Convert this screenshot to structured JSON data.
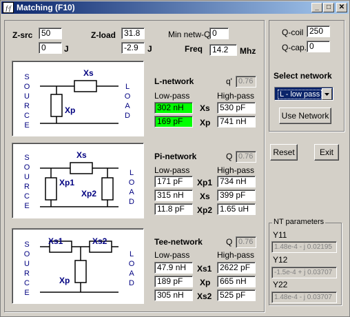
{
  "window": {
    "title": "Matching (F10)",
    "icon_text": "f·f",
    "min": "_",
    "max": "□",
    "close": "✕"
  },
  "source_load": {
    "zsrc_label": "Z-src",
    "zsrc_re": "50",
    "zsrc_im": "0",
    "zsrc_j": "J",
    "zload_label": "Z-load",
    "zload_re": "31.8",
    "zload_im": "-2.9",
    "zload_j": "J",
    "min_q_label": "Min netw-Q",
    "min_q": "0",
    "freq_label": "Freq",
    "freq": "14.2",
    "freq_unit": "Mhz"
  },
  "diagram": {
    "source_letters": [
      "S",
      "O",
      "U",
      "R",
      "C",
      "E"
    ],
    "load_letters": [
      "L",
      "O",
      "A",
      "D"
    ],
    "l_xs": "Xs",
    "l_xp": "Xp",
    "pi_xs": "Xs",
    "pi_xp1": "Xp1",
    "pi_xp2": "Xp2",
    "tee_xs1": "Xs1",
    "tee_xs2": "Xs2",
    "tee_xp": "Xp"
  },
  "l_network": {
    "title": "L-network",
    "q_label": "q'",
    "q": "0.76",
    "lowpass": "Low-pass",
    "highpass": "High-pass",
    "rows": [
      {
        "lp": "302 nH",
        "name": "Xs",
        "hp": "530 pF"
      },
      {
        "lp": "169 pF",
        "name": "Xp",
        "hp": "741 nH"
      }
    ]
  },
  "pi_network": {
    "title": "Pi-network",
    "q_label": "Q",
    "q": "0.76",
    "lowpass": "Low-pass",
    "highpass": "High-pass",
    "rows": [
      {
        "lp": "171 pF",
        "name": "Xp1",
        "hp": "734 nH"
      },
      {
        "lp": "315 nH",
        "name": "Xs",
        "hp": "399 pF"
      },
      {
        "lp": "11.8 pF",
        "name": "Xp2",
        "hp": "1.65 uH"
      }
    ]
  },
  "tee_network": {
    "title": "Tee-network",
    "q_label": "Q",
    "q": "0.76",
    "lowpass": "Low-pass",
    "highpass": "High-pass",
    "rows": [
      {
        "lp": "47.9 nH",
        "name": "Xs1",
        "hp": "2622 pF"
      },
      {
        "lp": "189 pF",
        "name": "Xp",
        "hp": "665 nH"
      },
      {
        "lp": "305 nH",
        "name": "Xs2",
        "hp": "525 pF"
      }
    ]
  },
  "right_panel": {
    "q_coil_label": "Q-coil",
    "q_coil": "250",
    "q_cap_label": "Q-cap.",
    "q_cap": "0",
    "select_label": "Select network",
    "select_value": "L - low pass",
    "use_network": "Use Network",
    "reset": "Reset",
    "exit": "Exit",
    "nt_title": "NT parameters",
    "y11_label": "Y11",
    "y11": "1.48e-4 - j 0.02195",
    "y12_label": "Y12",
    "y12": "-1.5e-4 + j 0.03707",
    "y22_label": "Y22",
    "y22": "1.48e-4 - j 0.03707"
  }
}
